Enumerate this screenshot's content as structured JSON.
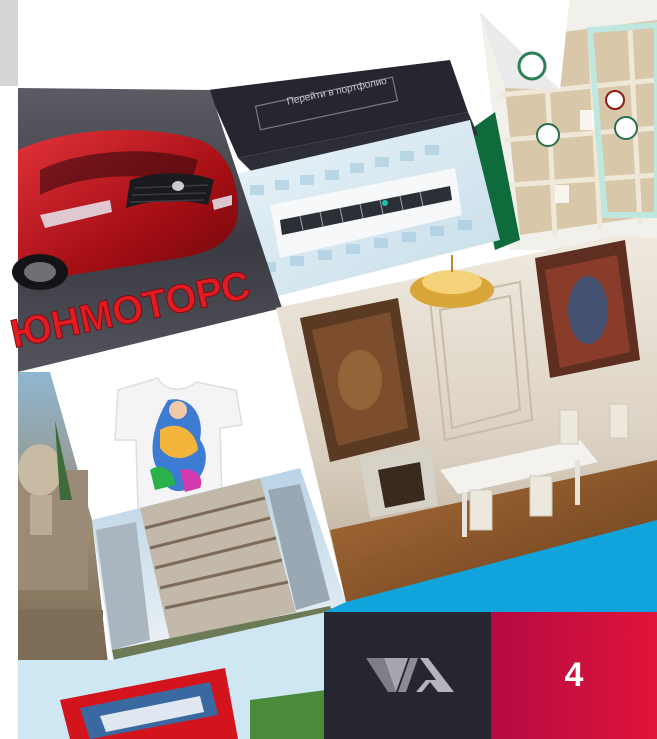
{
  "collage": {
    "promo_button": "Перейти в портфолио",
    "motors_brand": "ЮНМОТОРС",
    "logo_text": "VIA",
    "page_number": "4"
  },
  "colors": {
    "dark_panel": "#262630",
    "accent_red": "#e1143a",
    "accent_crimson": "#b40a43",
    "accent_cyan": "#11a3dc",
    "car_red": "#c4141c",
    "motors_blue": "#1c6ee6",
    "motors_red": "#ea1c24"
  },
  "icons": [
    "via-logo-icon",
    "car-image",
    "air-conditioner-image",
    "tshirt-image",
    "interior-image",
    "buildings-image",
    "truck-image",
    "porcelain-shelves-image",
    "tablet-device-image"
  ]
}
